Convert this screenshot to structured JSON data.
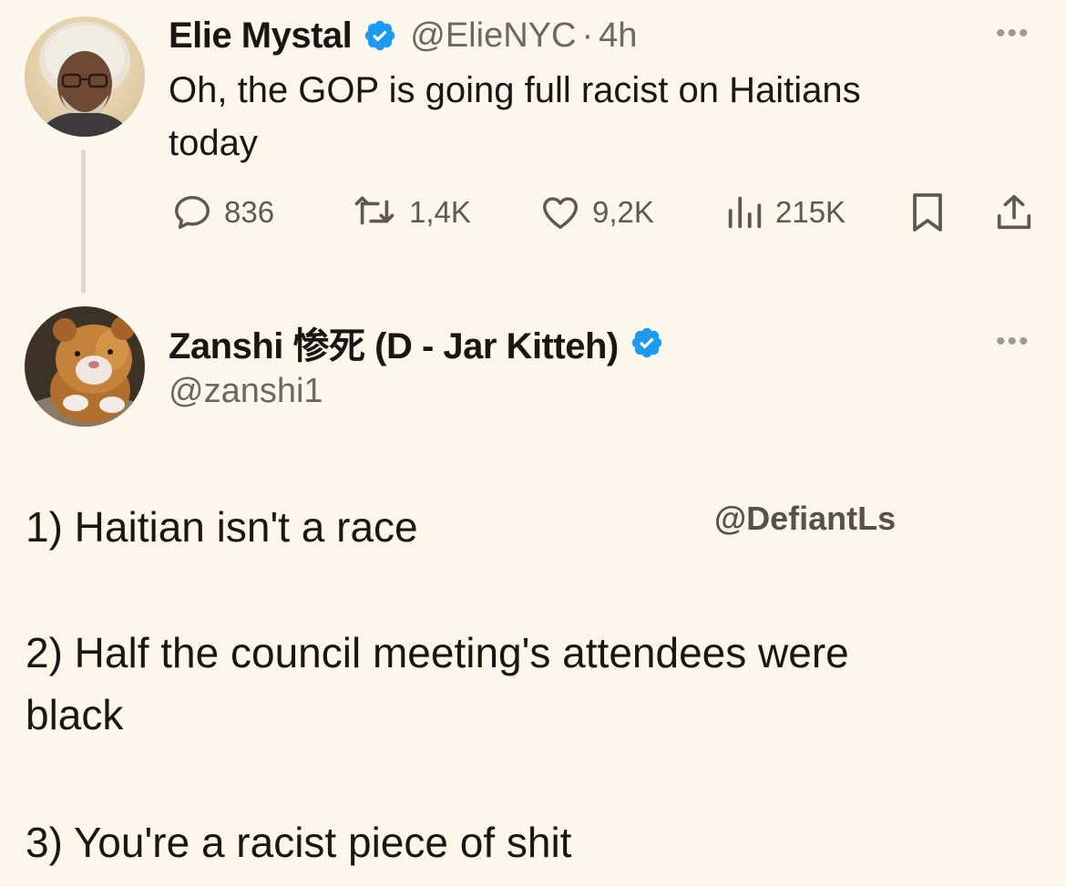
{
  "original_tweet": {
    "author_name": "Elie Mystal",
    "handle": "@ElieNYC",
    "separator": "·",
    "time": "4h",
    "text_line1": "Oh, the GOP is going full racist on Haitians",
    "text_line2": "today",
    "stats": {
      "replies": "836",
      "retweets": "1,4K",
      "likes": "9,2K",
      "views": "215K"
    },
    "more_label": "•••"
  },
  "reply_tweet": {
    "author_name": "Zanshi 惨死 (D - Jar Kitteh)",
    "handle": "@zanshi1",
    "more_label": "•••",
    "lines": {
      "point1": "1) Haitian isn't a race",
      "point2_line1": "2) Half the council meeting's attendees were",
      "point2_line2": "black",
      "point3": "3) You're a racist piece of shit"
    }
  },
  "watermark": "@DefiantLs",
  "icons": {
    "verified": "verified-badge-icon",
    "reply": "reply-icon",
    "retweet": "retweet-icon",
    "like": "heart-icon",
    "views": "views-chart-icon",
    "bookmark": "bookmark-icon",
    "share": "share-icon"
  },
  "colors": {
    "background": "#fcf7ec",
    "verified_blue": "#1d9bf0",
    "text": "#1d1512",
    "muted": "#6d6763"
  }
}
